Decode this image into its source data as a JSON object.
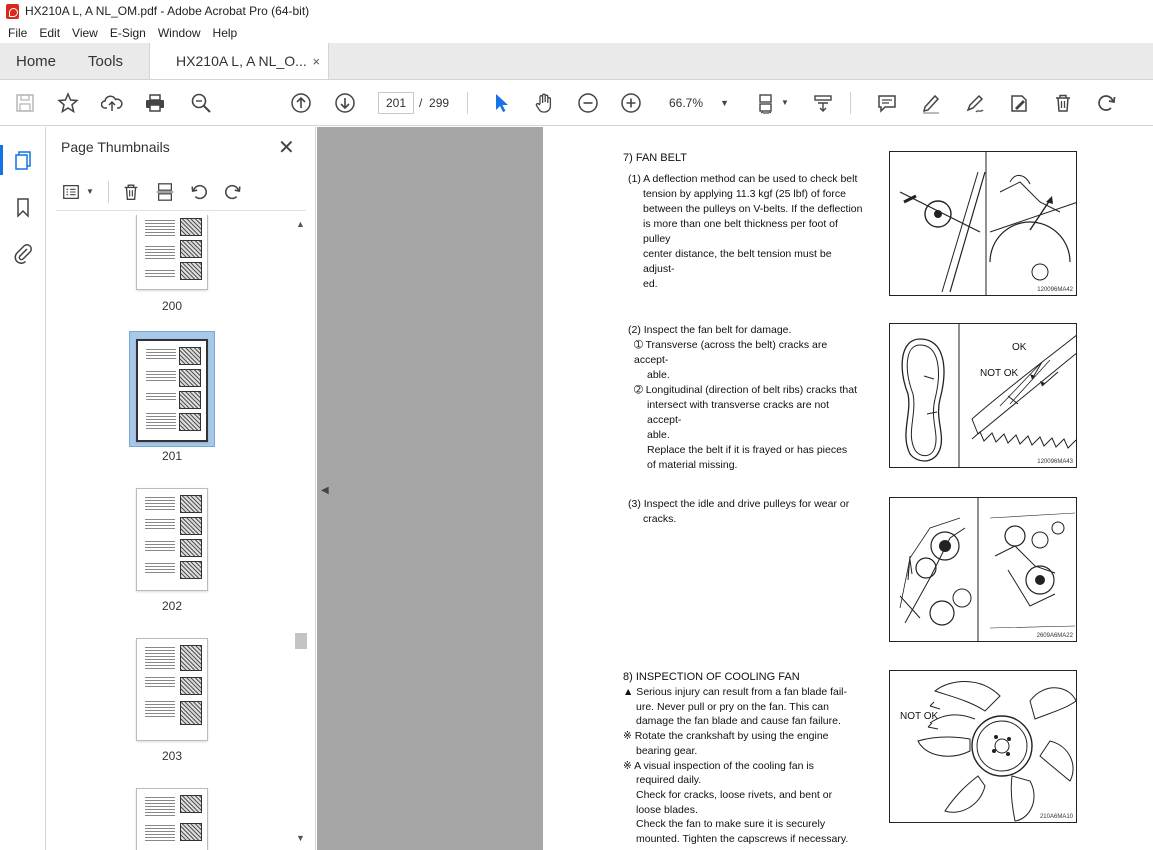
{
  "window": {
    "title": "HX210A L, A NL_OM.pdf - Adobe Acrobat Pro (64-bit)"
  },
  "menu": [
    "File",
    "Edit",
    "View",
    "E-Sign",
    "Window",
    "Help"
  ],
  "tabs": {
    "home": "Home",
    "tools": "Tools",
    "document": "HX210A L, A NL_O...",
    "close": "×"
  },
  "toolbar": {
    "page_current": "201",
    "page_separator": "/",
    "page_total": "299",
    "zoom": "66.7%",
    "icons": [
      "save-icon",
      "star-icon",
      "upload-icon",
      "print-icon",
      "search-icon",
      "page-up-icon",
      "page-down-icon",
      "select-cursor-icon",
      "hand-icon",
      "zoom-out-icon",
      "zoom-in-icon",
      "zoom-dropdown-icon",
      "page-fit-icon",
      "scroll-mode-icon",
      "comment-icon",
      "highlight-icon",
      "sign-icon",
      "edit-icon",
      "delete-icon",
      "redo-icon"
    ]
  },
  "sidebar": {
    "title": "Page Thumbnails",
    "close": "✕",
    "thumbnails": [
      {
        "label": "200"
      },
      {
        "label": "201",
        "selected": true
      },
      {
        "label": "202"
      },
      {
        "label": "203"
      }
    ]
  },
  "page": {
    "section7_title": "7) FAN BELT",
    "s7_item1": [
      "(1) A deflection method can be used to check belt",
      "tension by applying 11.3 kgf (25 lbf) of force",
      "between the pulleys on V-belts. If the deflection",
      "is more than one belt thickness per foot of pulley",
      "center distance, the belt tension must be adjust-",
      "ed."
    ],
    "s7_item2": [
      "(2) Inspect the fan belt for damage.",
      "➀ Transverse (across the belt) cracks are accept-",
      "able.",
      "➁ Longitudinal (direction of belt ribs) cracks that",
      "intersect with transverse cracks are not accept-",
      "able.",
      "Replace the belt if it is frayed or has pieces",
      "of material missing."
    ],
    "s7_item3": [
      "(3) Inspect the idle and drive pulleys for wear or",
      "cracks."
    ],
    "section8_title": "8) INSPECTION OF COOLING FAN",
    "s8_lines": [
      "▲ Serious injury can result from a fan blade fail-",
      "ure.  Never pull or pry on the fan.  This can",
      "damage the fan blade and cause fan failure.",
      "※ Rotate the crankshaft by using the engine",
      "bearing gear.",
      "※ A visual inspection of the cooling fan is",
      "required daily.",
      "Check for cracks, loose rivets, and bent or",
      "loose blades.",
      "Check the fan to make sure it is securely",
      "mounted.  Tighten the capscrews if necessary."
    ],
    "fig1_code": "120096MA42",
    "fig2_code": "120096MA43",
    "fig2_ok": "OK",
    "fig2_notok": "NOT OK",
    "fig3_code": "2609A6MA22",
    "fig4_code": "210A6MA10",
    "fig4_notok": "NOT OK"
  },
  "colors": {
    "accent": "#1473e6",
    "doc_bg": "#a6a6a6",
    "acrobat_red": "#d9281c"
  }
}
